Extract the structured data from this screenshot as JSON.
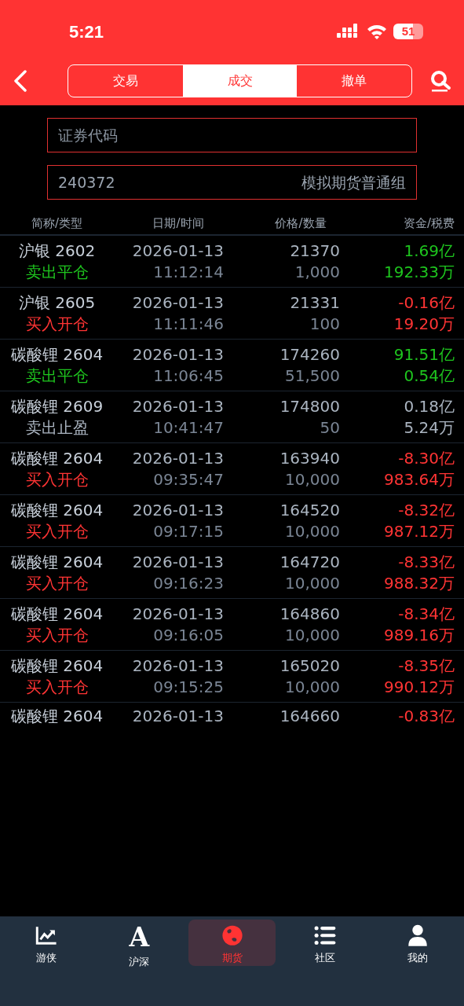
{
  "status_bar": {
    "time": "5:21",
    "battery": "51"
  },
  "tabs": [
    {
      "label": "交易",
      "selected": false
    },
    {
      "label": "成交",
      "selected": true
    },
    {
      "label": "撤单",
      "selected": false
    }
  ],
  "code_field": {
    "placeholder": "证券代码"
  },
  "account": {
    "number": "240372",
    "group": "模拟期货普通组"
  },
  "table": {
    "columns": [
      "简称/类型",
      "日期/时间",
      "价格/数量",
      "资金/税费"
    ],
    "rows": [
      {
        "name": "沪银 2602",
        "type": "卖出平仓",
        "color": "#1ec51e",
        "date": "2026-01-13",
        "time": "11:12:14",
        "price": "21370",
        "quantity": "1,000",
        "amount": "1.69亿",
        "fee": "192.33万"
      },
      {
        "name": "沪银 2605",
        "type": "买入开仓",
        "color": "#ff3434",
        "date": "2026-01-13",
        "time": "11:11:46",
        "price": "21331",
        "quantity": "100",
        "amount": "-0.16亿",
        "fee": "19.20万"
      },
      {
        "name": "碳酸锂 2604",
        "type": "卖出平仓",
        "color": "#1ec51e",
        "date": "2026-01-13",
        "time": "11:06:45",
        "price": "174260",
        "quantity": "51,500",
        "amount": "91.51亿",
        "fee": "0.54亿"
      },
      {
        "name": "碳酸锂 2609",
        "type": "卖出止盈",
        "color": "#aab4c0",
        "date": "2026-01-13",
        "time": "10:41:47",
        "price": "174800",
        "quantity": "50",
        "amount": "0.18亿",
        "fee": "5.24万"
      },
      {
        "name": "碳酸锂 2604",
        "type": "买入开仓",
        "color": "#ff3434",
        "date": "2026-01-13",
        "time": "09:35:47",
        "price": "163940",
        "quantity": "10,000",
        "amount": "-8.30亿",
        "fee": "983.64万"
      },
      {
        "name": "碳酸锂 2604",
        "type": "买入开仓",
        "color": "#ff3434",
        "date": "2026-01-13",
        "time": "09:17:15",
        "price": "164520",
        "quantity": "10,000",
        "amount": "-8.32亿",
        "fee": "987.12万"
      },
      {
        "name": "碳酸锂 2604",
        "type": "买入开仓",
        "color": "#ff3434",
        "date": "2026-01-13",
        "time": "09:16:23",
        "price": "164720",
        "quantity": "10,000",
        "amount": "-8.33亿",
        "fee": "988.32万"
      },
      {
        "name": "碳酸锂 2604",
        "type": "买入开仓",
        "color": "#ff3434",
        "date": "2026-01-13",
        "time": "09:16:05",
        "price": "164860",
        "quantity": "10,000",
        "amount": "-8.34亿",
        "fee": "989.16万"
      },
      {
        "name": "碳酸锂 2604",
        "type": "买入开仓",
        "color": "#ff3434",
        "date": "2026-01-13",
        "time": "09:15:25",
        "price": "165020",
        "quantity": "10,000",
        "amount": "-8.35亿",
        "fee": "990.12万"
      },
      {
        "kind": "partial",
        "name": "碳酸锂 2604",
        "color": "#ff3434",
        "date": "2026-01-13",
        "price": "164660",
        "amount": "-0.83亿"
      }
    ]
  },
  "bottom_nav": [
    {
      "label": "游侠",
      "selected": false
    },
    {
      "label": "沪深",
      "glyph": "A",
      "selected": false
    },
    {
      "label": "期货",
      "selected": true
    },
    {
      "label": "社区",
      "selected": false
    },
    {
      "label": "我的",
      "selected": false
    }
  ]
}
